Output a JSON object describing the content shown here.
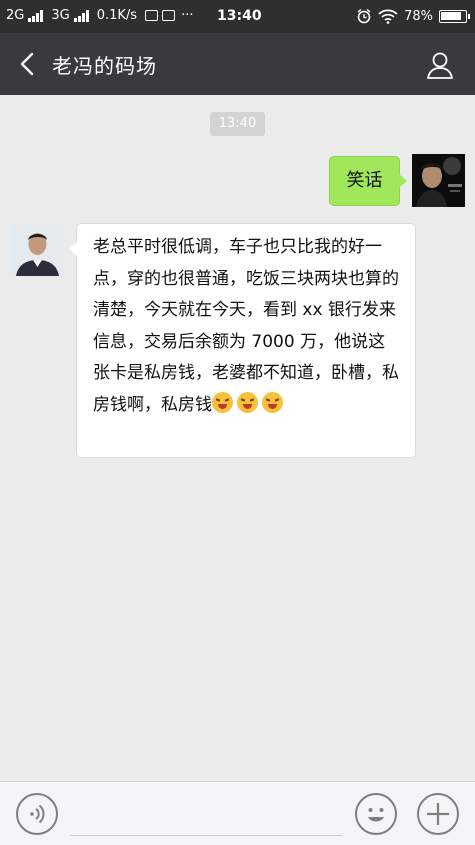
{
  "status_bar": {
    "network1": "2G",
    "network2": "3G",
    "speed": "0.1K/s",
    "more": "···",
    "time": "13:40",
    "battery": "78%"
  },
  "header": {
    "title": "老冯的码场"
  },
  "chat": {
    "timestamp": "13:40",
    "messages": [
      {
        "side": "right",
        "text": "笑话"
      },
      {
        "side": "left",
        "text": "老总平时很低调，车子也只比我的好一点，穿的也很普通，吃饭三块两块也算的清楚，今天就在今天，看到 xx 银行发来信息，交易后余额为 7000 万，他说这张卡是私房钱，老婆都不知道，卧槽，私房钱啊，私房钱",
        "emoji_count": 3
      }
    ]
  },
  "icons": {
    "back": "chevron-left-icon",
    "profile": "person-icon",
    "voice": "voice-icon",
    "emoji": "smiley-icon",
    "more": "plus-icon"
  },
  "colors": {
    "status_bg": "#2f2f2f",
    "header_bg": "#393a3f",
    "chat_bg": "#ebebeb",
    "self_bubble": "#a0e75a",
    "other_bubble": "#ffffff"
  }
}
